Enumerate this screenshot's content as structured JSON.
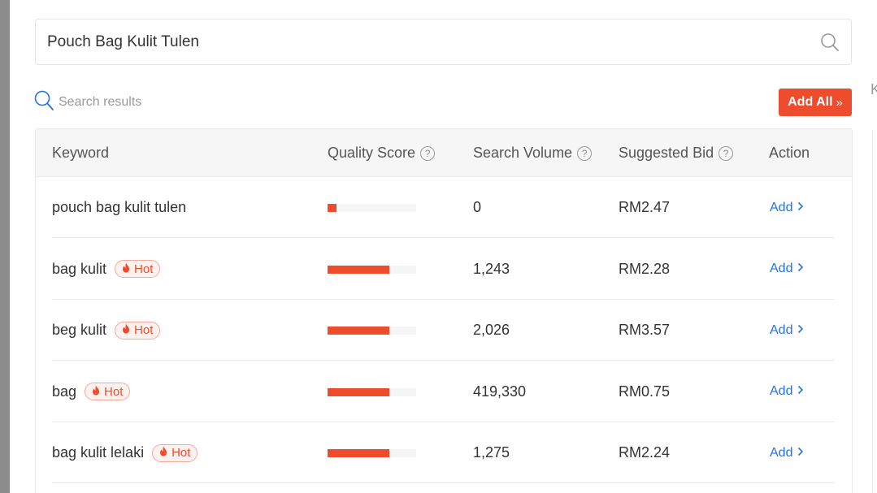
{
  "search": {
    "value": "Pouch Bag Kulit Tulen",
    "icon": "search-icon"
  },
  "results_label": "Search results",
  "add_all_label": "Add All",
  "right_stub_text": "K",
  "table": {
    "headers": {
      "keyword": "Keyword",
      "quality_score": "Quality Score",
      "search_volume": "Search Volume",
      "suggested_bid": "Suggested Bid",
      "action": "Action"
    },
    "help_glyph": "?",
    "rows": [
      {
        "keyword": "pouch bag kulit tulen",
        "hot": false,
        "hot_label": "",
        "quality_score_fraction": 0.1,
        "search_volume": "0",
        "suggested_bid": "RM2.47",
        "action": "Add"
      },
      {
        "keyword": "bag kulit",
        "hot": true,
        "hot_label": "Hot",
        "quality_score_fraction": 0.7,
        "search_volume": "1,243",
        "suggested_bid": "RM2.28",
        "action": "Add"
      },
      {
        "keyword": "beg kulit",
        "hot": true,
        "hot_label": "Hot",
        "quality_score_fraction": 0.7,
        "search_volume": "2,026",
        "suggested_bid": "RM3.57",
        "action": "Add"
      },
      {
        "keyword": "bag",
        "hot": true,
        "hot_label": "Hot",
        "quality_score_fraction": 0.7,
        "search_volume": "419,330",
        "suggested_bid": "RM0.75",
        "action": "Add"
      },
      {
        "keyword": "bag kulit lelaki",
        "hot": true,
        "hot_label": "Hot",
        "quality_score_fraction": 0.7,
        "search_volume": "1,275",
        "suggested_bid": "RM2.24",
        "action": "Add"
      }
    ]
  },
  "colors": {
    "accent": "#ee4d2d",
    "link": "#2673dd",
    "bar_track": "#f5f5f5"
  }
}
